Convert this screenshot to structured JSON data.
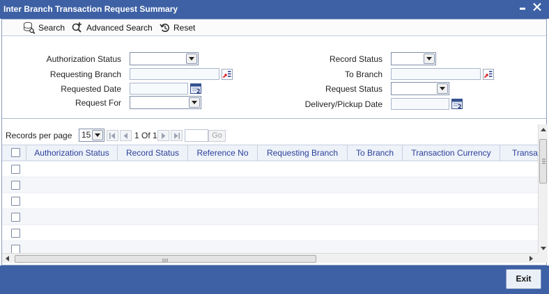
{
  "window": {
    "title": "Inter Branch Transaction Request Summary",
    "minimize_glyph": "▬",
    "close_glyph": "✕"
  },
  "toolbar": {
    "search_label": "Search",
    "advanced_search_label": "Advanced Search",
    "reset_label": "Reset"
  },
  "form": {
    "authorization_status_label": "Authorization Status",
    "requesting_branch_label": "Requesting Branch",
    "requested_date_label": "Requested Date",
    "request_for_label": "Request For",
    "record_status_label": "Record Status",
    "to_branch_label": "To Branch",
    "request_status_label": "Request Status",
    "delivery_pickup_date_label": "Delivery/Pickup Date",
    "authorization_status_value": "",
    "requesting_branch_value": "",
    "requested_date_value": "",
    "request_for_value": "",
    "record_status_value": "",
    "to_branch_value": "",
    "request_status_value": "",
    "delivery_pickup_date_value": ""
  },
  "pager": {
    "records_per_page_label": "Records per page",
    "records_per_page_value": "15",
    "page_info": "1 Of 1",
    "goto_value": "",
    "go_label": "Go"
  },
  "grid": {
    "columns": [
      "Authorization Status",
      "Record Status",
      "Reference No",
      "Requesting Branch",
      "To Branch",
      "Transaction Currency",
      "Transa"
    ],
    "row_count": 6
  },
  "footer": {
    "exit_label": "Exit"
  },
  "icons": {
    "lov": "list-of-values-icon",
    "calendar": "calendar-icon"
  },
  "colors": {
    "title_bar": "#3e61a5",
    "header_text": "#2a3f9a"
  }
}
